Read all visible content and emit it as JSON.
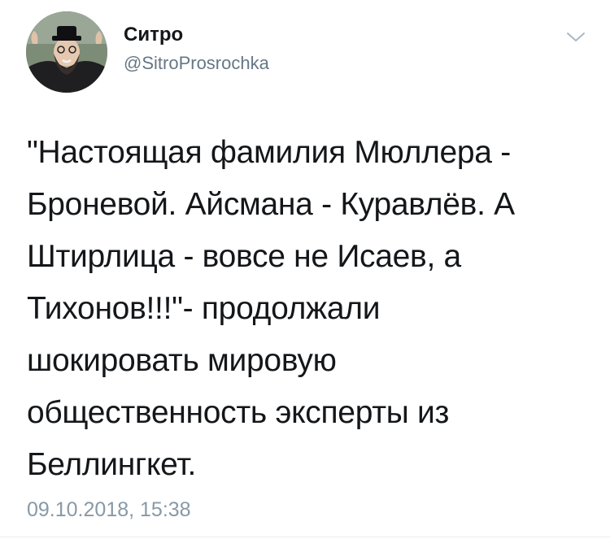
{
  "tweet": {
    "author": {
      "display_name": "Ситро",
      "handle": "@SitroProsrochka",
      "avatar_icon": "profile-photo-avatar"
    },
    "menu_icon": "chevron-down-icon",
    "text": "\"Настоящая фамилия Мюллера -\nБроневой. Айсмана - Куравлёв. А\nШтирлица - вовсе не Исаев, а\nТихонов!!!\"- продолжали\nшокировать мировую\nобщественность эксперты из\nБеллингкет.",
    "timestamp": "09.10.2018, 15:38"
  },
  "colors": {
    "text": "#14171a",
    "secondary": "#657786",
    "timestamp": "#8899a6",
    "divider": "#e6ecf0"
  }
}
